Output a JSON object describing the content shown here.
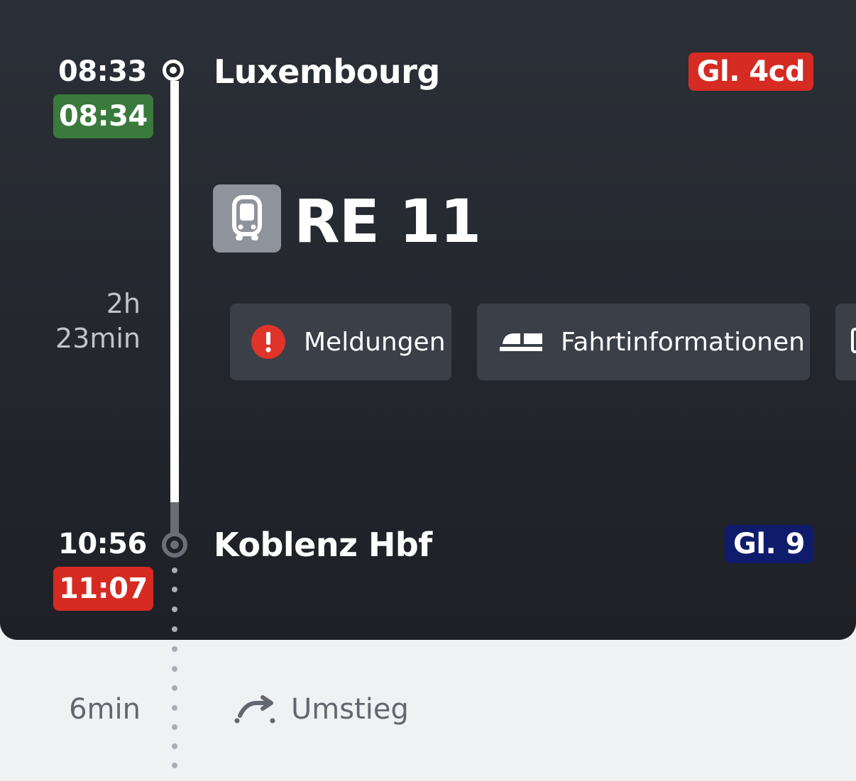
{
  "departure": {
    "scheduled_time": "08:33",
    "actual_time": "08:34",
    "actual_status_color": "#3a7a3c",
    "station": "Luxembourg",
    "platform": "Gl. 4cd",
    "platform_color": "#d52b22"
  },
  "train": {
    "icon": "regional-train-icon",
    "name": "RE 11"
  },
  "duration": {
    "hours": "2h",
    "minutes": "23min"
  },
  "chips": {
    "messages": {
      "icon": "alert-icon",
      "label": "Meldungen"
    },
    "trip_info": {
      "icon": "train-info-icon",
      "label": "Fahrtinformationen"
    }
  },
  "arrival": {
    "scheduled_time": "10:56",
    "actual_time": "11:07",
    "actual_status_color": "#d52b22",
    "station": "Koblenz Hbf",
    "platform": "Gl. 9",
    "platform_color": "#0f1b6b"
  },
  "transfer": {
    "duration": "6min",
    "icon": "transfer-arrow-icon",
    "label": "Umstieg"
  }
}
